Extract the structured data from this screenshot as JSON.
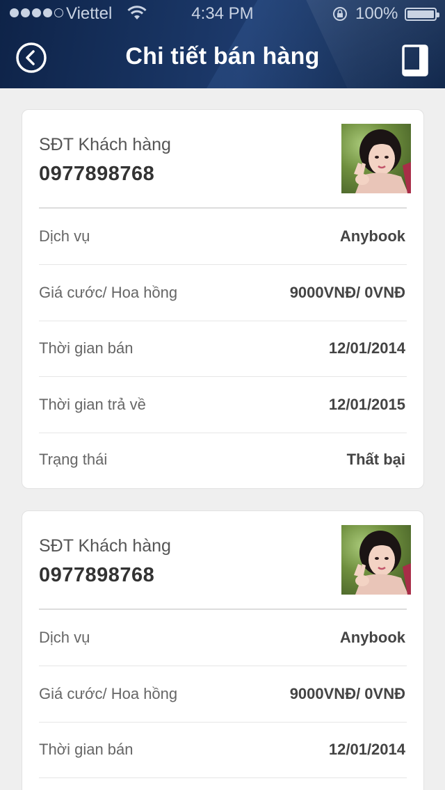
{
  "status_bar": {
    "carrier": "Viettel",
    "time": "4:34 PM",
    "battery": "100%",
    "signal_bars_filled": 4,
    "signal_bars_total": 5
  },
  "header": {
    "title": "Chi tiết bán hàng",
    "back_icon": "back-circle-icon",
    "book_icon": "book-icon"
  },
  "cards": [
    {
      "customer_label": "SĐT Khách hàng",
      "customer_phone": "0977898768",
      "rows": [
        {
          "label": "Dịch vụ",
          "value": "Anybook"
        },
        {
          "label": "Giá cước/ Hoa hồng",
          "value": "9000VNĐ/ 0VNĐ"
        },
        {
          "label": "Thời gian bán",
          "value": "12/01/2014"
        },
        {
          "label": "Thời gian trả về",
          "value": "12/01/2015"
        },
        {
          "label": "Trạng thái",
          "value": "Thất bại"
        }
      ]
    },
    {
      "customer_label": "SĐT Khách hàng",
      "customer_phone": "0977898768",
      "rows": [
        {
          "label": "Dịch vụ",
          "value": "Anybook"
        },
        {
          "label": "Giá cước/ Hoa hồng",
          "value": "9000VNĐ/ 0VNĐ"
        },
        {
          "label": "Thời gian bán",
          "value": "12/01/2014"
        }
      ]
    }
  ],
  "colors": {
    "header_bg": "#17325f",
    "page_bg": "#efefef",
    "card_bg": "#ffffff"
  }
}
